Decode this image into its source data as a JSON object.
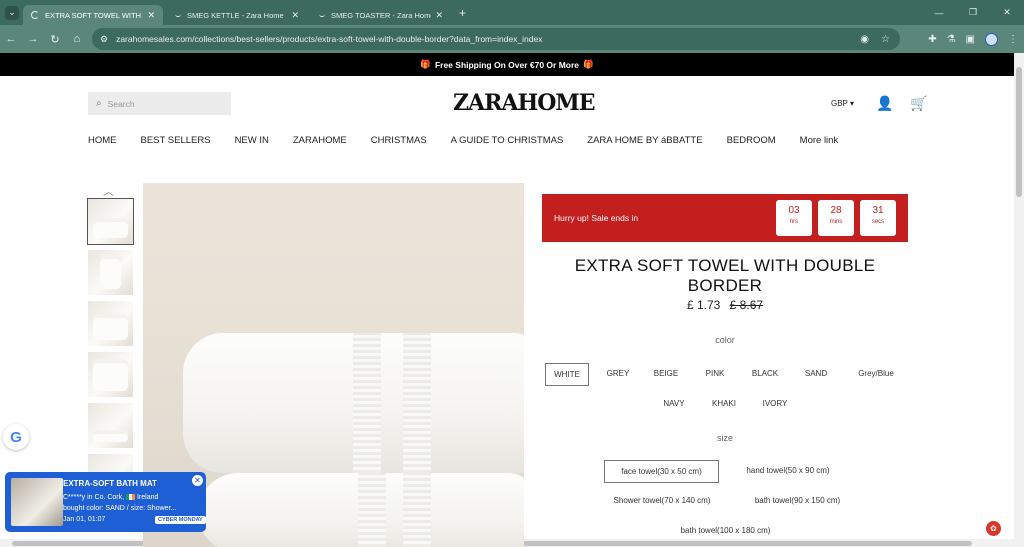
{
  "browser": {
    "tabs": [
      {
        "title": "EXTRA SOFT TOWEL WITH DOUBLE BORDER",
        "active": true
      },
      {
        "title": "SMEG KETTLE - Zara Home",
        "active": false
      },
      {
        "title": "SMEG TOASTER - Zara Home",
        "active": false
      }
    ],
    "url": "zarahomesales.com/collections/best-sellers/products/extra-soft-towel-with-double-border?data_from=index_index"
  },
  "banner": {
    "text": "Free Shipping On Over €70 Or More"
  },
  "header": {
    "search_placeholder": "Search",
    "logo": "ZARAHOME",
    "currency": "GBP"
  },
  "nav": {
    "items": [
      "HOME",
      "BEST SELLERS",
      "NEW IN",
      "ZARAHOME",
      "CHRISTMAS",
      "A GUIDE TO CHRISTMAS",
      "ZARA HOME BY áBBATTE",
      "BEDROOM",
      "More link"
    ]
  },
  "sale": {
    "text": "Hurry up!  Sale ends in",
    "hours": "03",
    "hours_label": "hrs",
    "mins": "28",
    "mins_label": "mins",
    "secs": "31",
    "secs_label": "secs"
  },
  "product": {
    "title": "EXTRA SOFT TOWEL WITH DOUBLE BORDER",
    "price": "£ 1.73",
    "old_price": "£ 8.67",
    "color_label": "color",
    "colors": [
      "WHITE",
      "GREY",
      "BEIGE",
      "PINK",
      "BLACK",
      "SAND",
      "Grey/Blue",
      "NAVY",
      "KHAKI",
      "IVORY"
    ],
    "selected_color": "WHITE",
    "size_label": "size",
    "sizes": [
      "face towel(30 x 50 cm)",
      "hand towel(50 x 90 cm)",
      "Shower towel(70 x 140 cm)",
      "bath towel(90 x 150 cm)",
      "bath towel(100 x 180 cm)"
    ],
    "selected_size": "face towel(30 x 50 cm)"
  },
  "popup": {
    "title": "EXTRA-SOFT BATH MAT",
    "line1": "C*****y in Co. Cork,",
    "country": "Ireland",
    "line2": "bought color: SAND / size: Shower...",
    "line3": "Jan 01, 01:07",
    "badge": "CYBER MONDAY"
  }
}
